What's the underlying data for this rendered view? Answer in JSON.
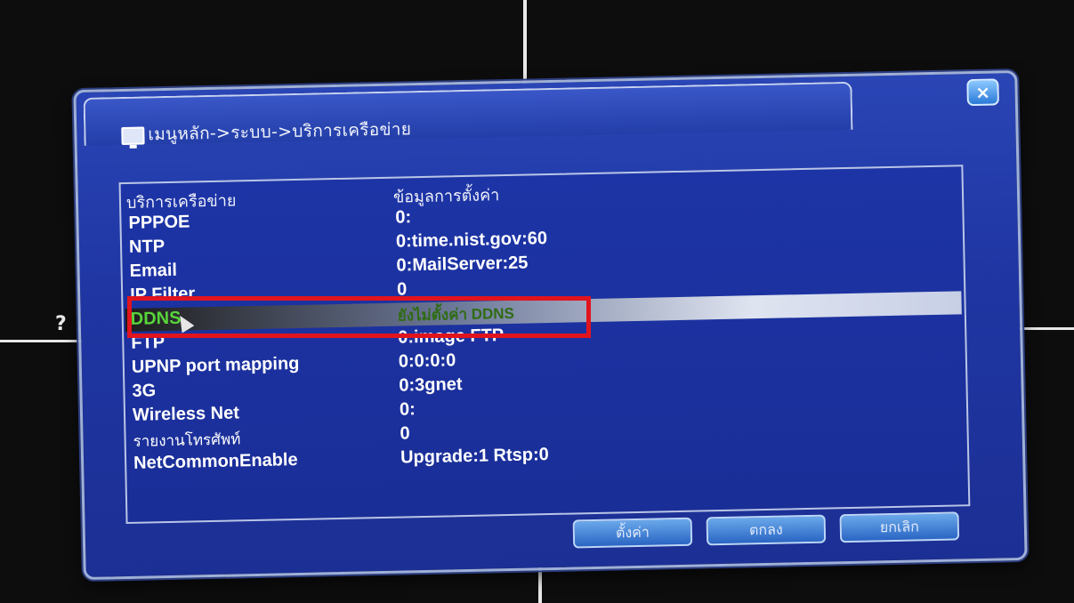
{
  "help": {
    "glyph": "?"
  },
  "dialog": {
    "title": "เมนูหลัก->ระบบ->บริการเครือข่าย",
    "icons": {
      "window": "monitor-icon",
      "close": "close-icon",
      "cursor": "mouse-pointer-icon"
    },
    "close_glyph": "×"
  },
  "table": {
    "headers": {
      "service": "บริการเครือข่าย",
      "config": "ข้อมูลการตั้งค่า"
    },
    "rows": [
      {
        "service": "PPPOE",
        "config": "0:"
      },
      {
        "service": "NTP",
        "config": "0:time.nist.gov:60"
      },
      {
        "service": "Email",
        "config": "0:MailServer:25"
      },
      {
        "service": "IP Filter",
        "config": "0"
      },
      {
        "service": "DDNS",
        "config": "ยังไม่ตั้งค่า DDNS",
        "selected": true
      },
      {
        "service": "FTP",
        "config": "0:image FTP"
      },
      {
        "service": "UPNP port mapping",
        "config": "0:0:0:0"
      },
      {
        "service": "3G",
        "config": "0:3gnet"
      },
      {
        "service": "Wireless Net",
        "config": "0:"
      },
      {
        "service": "รายงานโทรศัพท์",
        "config": "0"
      },
      {
        "service": "NetCommonEnable",
        "config": "Upgrade:1 Rtsp:0"
      }
    ]
  },
  "buttons": {
    "settings": "ตั้งค่า",
    "ok": "ตกลง",
    "cancel": "ยกเลิก"
  },
  "colors": {
    "dialog_bg": "#1f36a3",
    "highlight": "#e1141e",
    "selected_text": "#57d43a"
  }
}
